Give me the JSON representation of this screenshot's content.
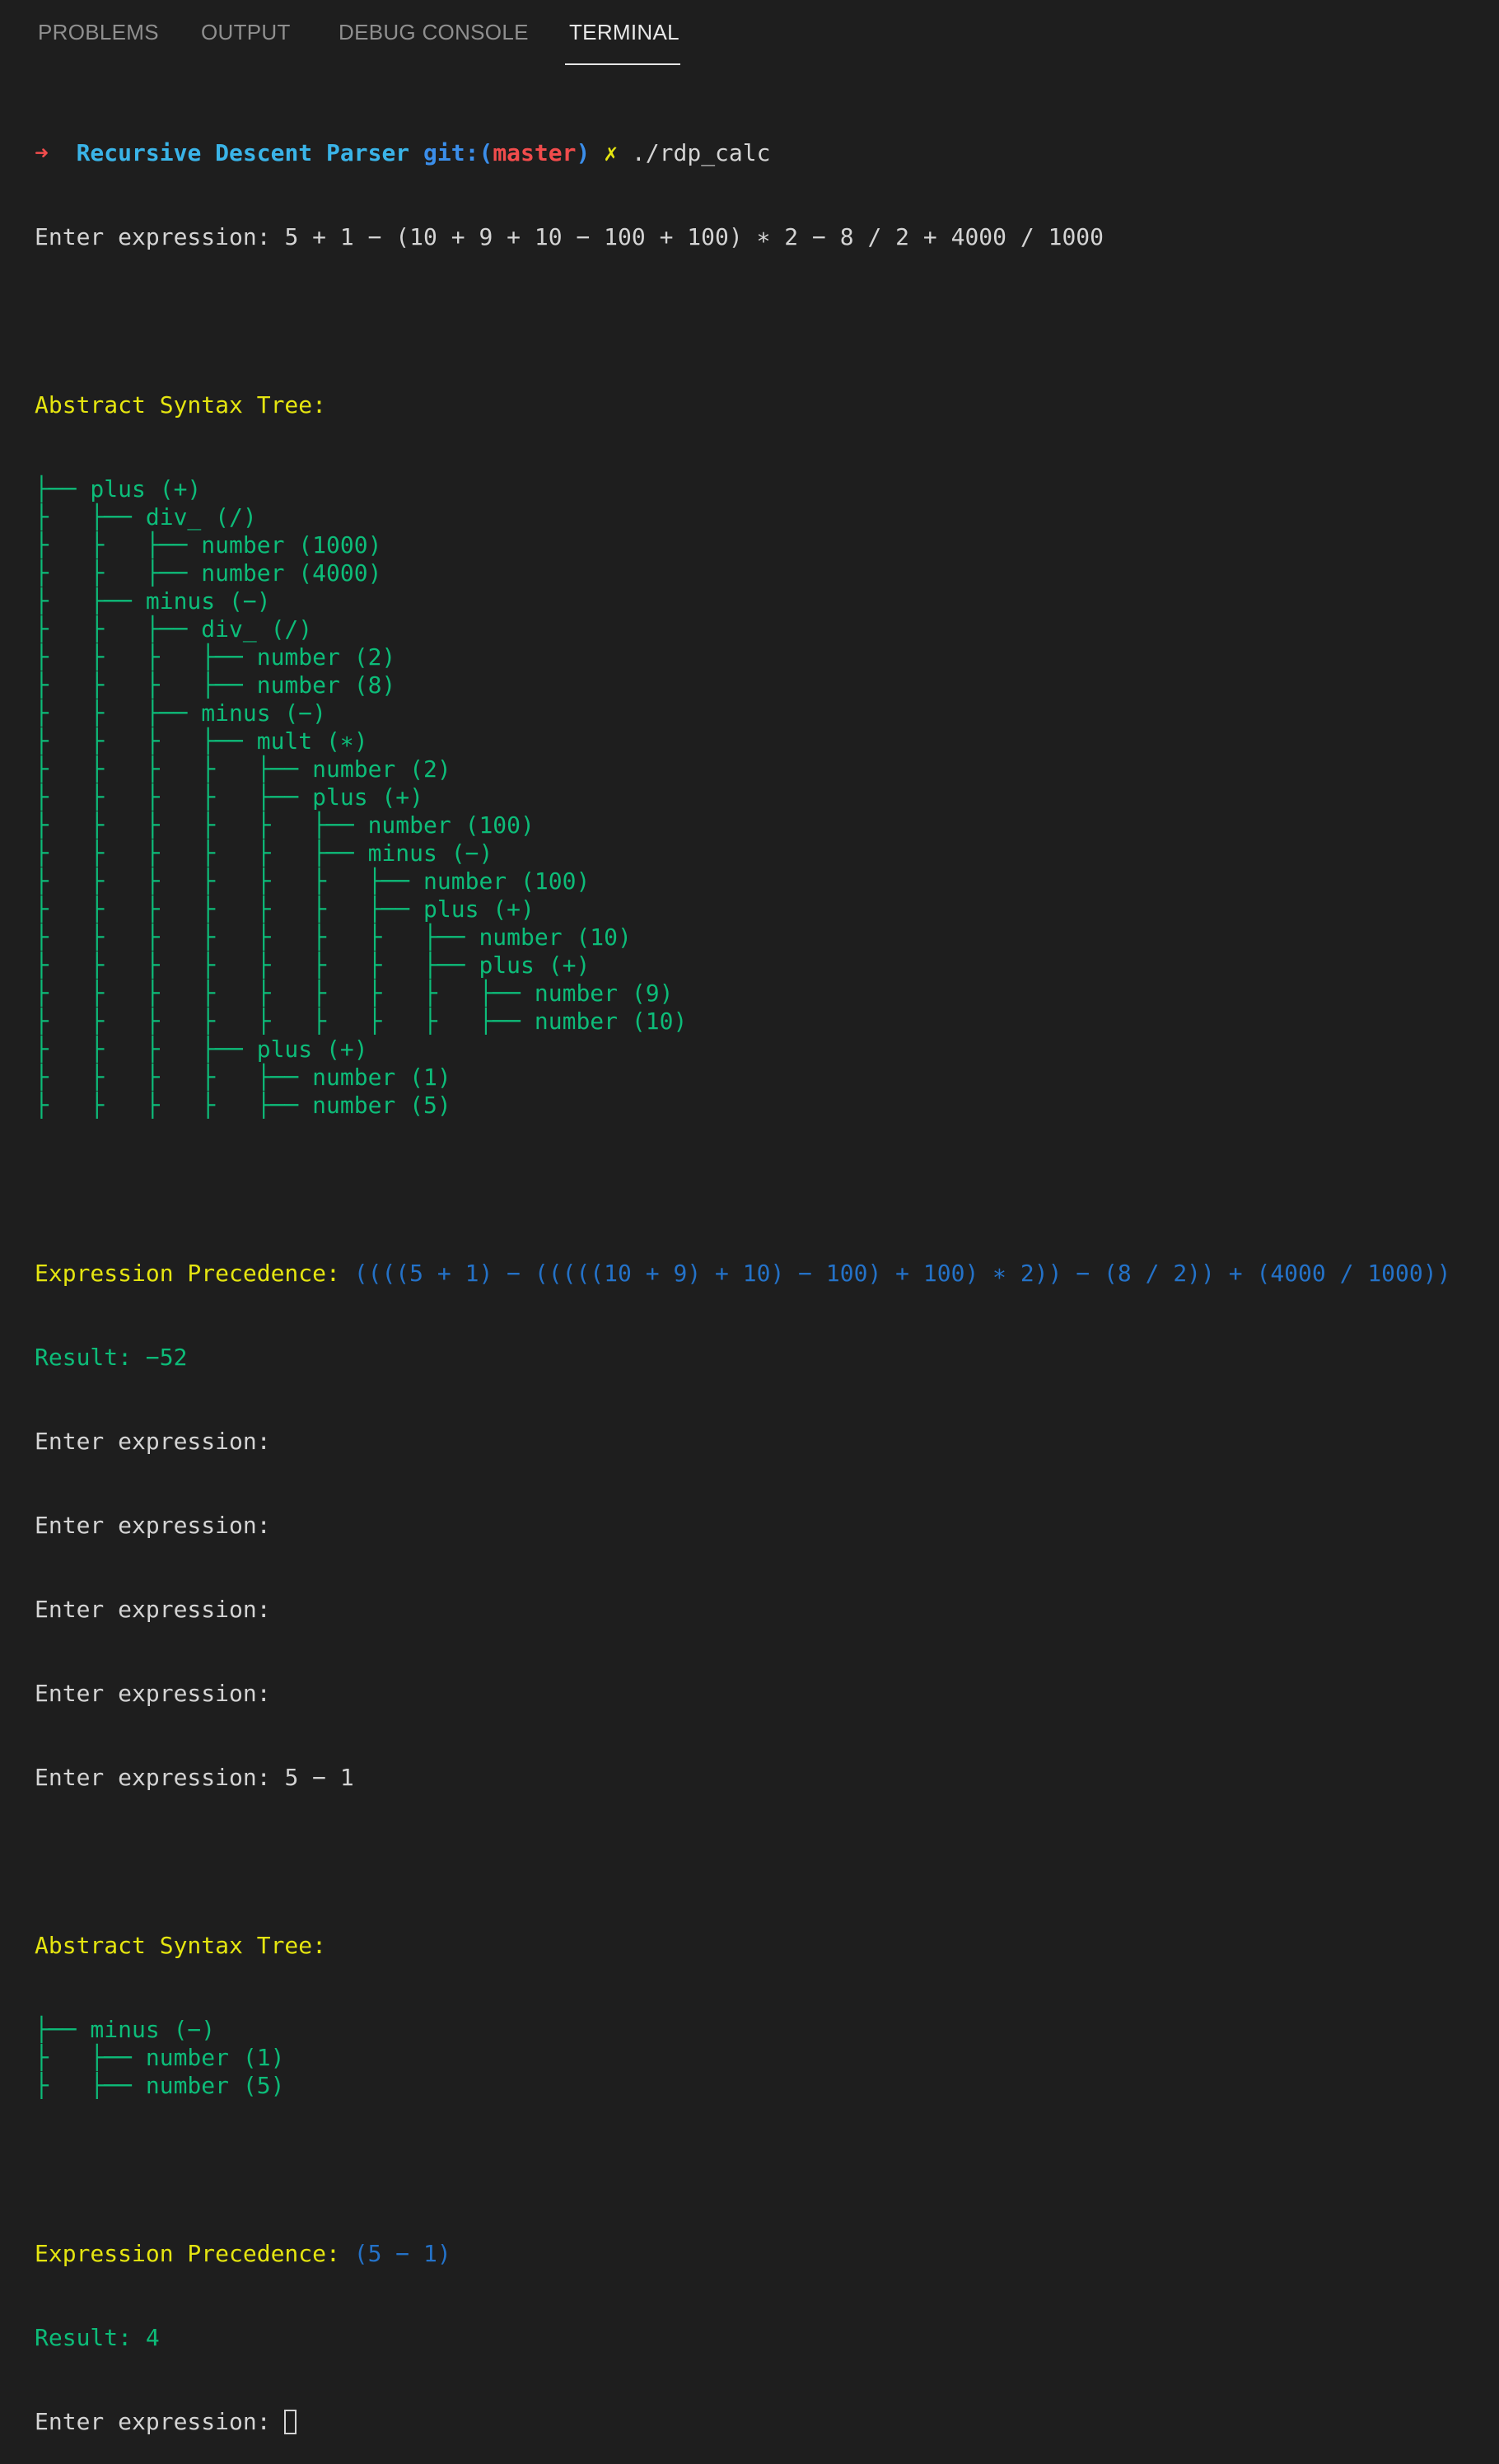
{
  "tabs": {
    "problems": "PROBLEMS",
    "output": "OUTPUT",
    "debug_console": "DEBUG CONSOLE",
    "terminal": "TERMINAL"
  },
  "colors": {
    "background": "#1e1e1e",
    "prompt_text": "#d4d4d4",
    "heading_yellow": "#e5e510",
    "tree_green": "#0dbc79",
    "precedence_blue": "#2472c8",
    "dir_cyan": "#3ab4e8",
    "branch_red": "#f14c4c"
  },
  "terminal": {
    "prompt": {
      "arrow": "➜",
      "dir": "Recursive Descent Parser",
      "git_prefix": "git:(",
      "branch": "master",
      "git_suffix": ")",
      "dirty_mark": "✗",
      "command": "./rdp_calc"
    },
    "first_run": {
      "input_label": "Enter expression: ",
      "input_value": "5 + 1 − (10 + 9 + 10 − 100 + 100) ∗ 2 − 8 / 2 + 4000 / 1000",
      "ast_heading": "Abstract Syntax Tree:",
      "tree_lines": [
        "├── plus (+)",
        "├   ├── div_ (/)",
        "├   ├   ├── number (1000)",
        "├   ├   ├── number (4000)",
        "├   ├── minus (−)",
        "├   ├   ├── div_ (/)",
        "├   ├   ├   ├── number (2)",
        "├   ├   ├   ├── number (8)",
        "├   ├   ├── minus (−)",
        "├   ├   ├   ├── mult (∗)",
        "├   ├   ├   ├   ├── number (2)",
        "├   ├   ├   ├   ├── plus (+)",
        "├   ├   ├   ├   ├   ├── number (100)",
        "├   ├   ├   ├   ├   ├── minus (−)",
        "├   ├   ├   ├   ├   ├   ├── number (100)",
        "├   ├   ├   ├   ├   ├   ├── plus (+)",
        "├   ├   ├   ├   ├   ├   ├   ├── number (10)",
        "├   ├   ├   ├   ├   ├   ├   ├── plus (+)",
        "├   ├   ├   ├   ├   ├   ├   ├   ├── number (9)",
        "├   ├   ├   ├   ├   ├   ├   ├   ├── number (10)",
        "├   ├   ├   ├── plus (+)",
        "├   ├   ├   ├   ├── number (1)",
        "├   ├   ├   ├   ├── number (5)"
      ],
      "precedence_label": "Expression Precedence: ",
      "precedence_value": "((((5 + 1) − (((((10 + 9) + 10) − 100) + 100) ∗ 2)) − (8 / 2)) + (4000 / 1000))",
      "result": "Result: −52"
    },
    "empty_prompts": [
      "Enter expression:",
      "Enter expression:",
      "Enter expression:",
      "Enter expression:"
    ],
    "second_run": {
      "input_label": "Enter expression: ",
      "input_value": "5 − 1",
      "ast_heading": "Abstract Syntax Tree:",
      "tree_lines": [
        "├── minus (−)",
        "├   ├── number (1)",
        "├   ├── number (5)"
      ],
      "precedence_label": "Expression Precedence: ",
      "precedence_value": "(5 − 1)",
      "result": "Result: 4"
    },
    "final_prompt": "Enter expression: "
  }
}
